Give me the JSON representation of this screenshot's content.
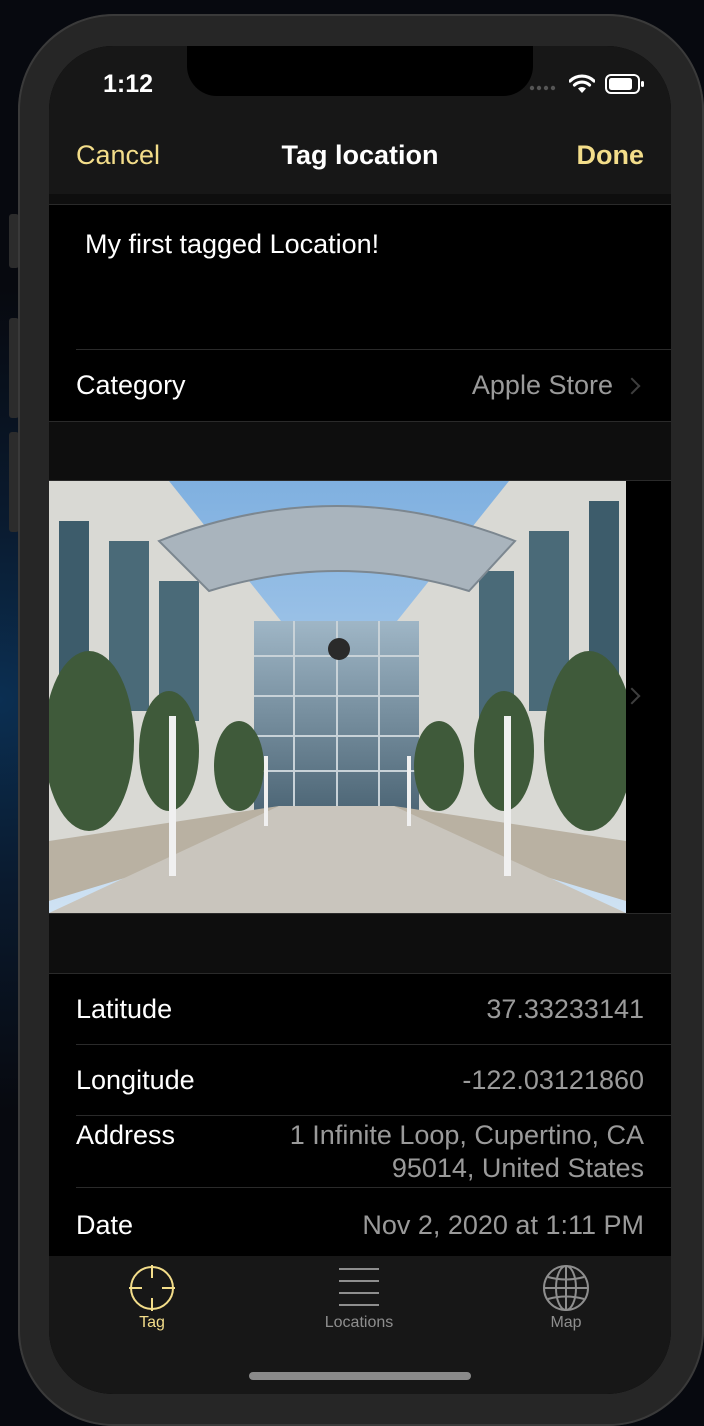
{
  "status": {
    "time": "1:12"
  },
  "nav": {
    "cancel": "Cancel",
    "title": "Tag location",
    "done": "Done"
  },
  "description": "My first tagged Location!",
  "category": {
    "label": "Category",
    "value": "Apple Store"
  },
  "photo": {
    "alt": "Apple Campus photo"
  },
  "details": {
    "latitude_label": "Latitude",
    "latitude": "37.33233141",
    "longitude_label": "Longitude",
    "longitude": "-122.03121860",
    "address_label": "Address",
    "address_line1": "1 Infinite Loop, Cupertino, CA",
    "address_line2": "95014, United States",
    "date_label": "Date",
    "date": "Nov 2, 2020 at 1:11 PM"
  },
  "tabs": [
    {
      "label": "Tag",
      "icon": "crosshair-icon",
      "selected": true
    },
    {
      "label": "Locations",
      "icon": "list-icon",
      "selected": false
    },
    {
      "label": "Map",
      "icon": "globe-icon",
      "selected": false
    }
  ],
  "colors": {
    "accent": "#f3dd8a",
    "background": "#000000",
    "bar": "#171717",
    "secondary_text": "#9a9a9a",
    "inactive_tab": "#8e8e8e"
  }
}
